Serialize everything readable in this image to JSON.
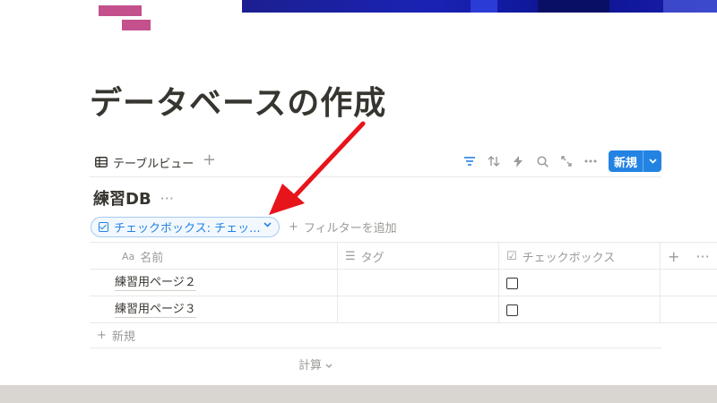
{
  "page": {
    "title": "データベースの作成"
  },
  "viewbar": {
    "view_label": "テーブルビュー",
    "add_view": "+",
    "new_label": "新規",
    "tools": [
      {
        "name": "filter-icon",
        "glyph": "≡",
        "active": true
      },
      {
        "name": "sort-icon",
        "glyph": "⇅",
        "active": false
      },
      {
        "name": "automation-icon",
        "glyph": "⚡",
        "active": false
      },
      {
        "name": "search-icon",
        "glyph": "⌕",
        "active": false
      },
      {
        "name": "expand-icon",
        "glyph": "⤢",
        "active": false
      },
      {
        "name": "more-icon",
        "glyph": "···",
        "active": false
      }
    ]
  },
  "database": {
    "title": "練習DB",
    "more": "···"
  },
  "filter": {
    "pill_label": "チェックボックス: チェッ...",
    "add_filter_label": "フィルターを追加"
  },
  "table": {
    "columns": [
      {
        "prefix": "Aa",
        "label": "名前"
      },
      {
        "prefix": "☰",
        "label": "タグ"
      },
      {
        "prefix": "☑",
        "label": "チェックボックス"
      }
    ],
    "add_column": "+",
    "column_more": "···",
    "rows": [
      {
        "name": "練習用ページ２",
        "tag": "",
        "checked": false
      },
      {
        "name": "練習用ページ３",
        "tag": "",
        "checked": false
      }
    ],
    "new_row_label": "新規",
    "calc_label": "計算"
  },
  "colors": {
    "accent": "#2383e2",
    "annotation_arrow": "#e8141c",
    "logo": "#c4508d"
  }
}
